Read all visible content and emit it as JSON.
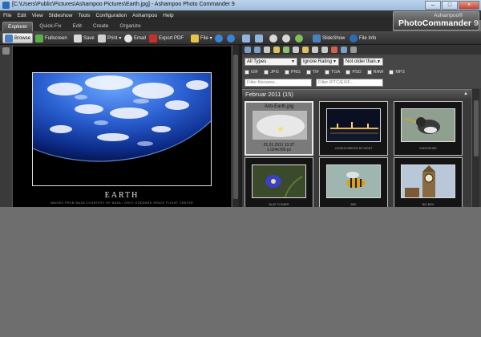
{
  "window": {
    "title": "[C:\\Users\\Public\\Pictures\\Ashampoo Pictures\\Earth.jpg] - Ashampoo Photo Commander 9",
    "min_label": "–",
    "max_label": "□",
    "close_label": "×"
  },
  "menu": [
    "File",
    "Edit",
    "View",
    "Slideshow",
    "Tools",
    "Configuration",
    "Ashampoo",
    "Help"
  ],
  "brand": {
    "top": "Ashampoo®",
    "name": "PhotoCommander",
    "version": "9"
  },
  "tabs": [
    "Explorer",
    "Quick-Fix",
    "Edit",
    "Create",
    "Organize"
  ],
  "toolbar": {
    "browse": "Browse",
    "fullscreen": "Fullscreen",
    "save": "Save",
    "print": "Print",
    "email": "Email",
    "export_pdf": "Export PDF",
    "file": "File",
    "slideshow": "SlideShow",
    "file_info": "File Info"
  },
  "viewer": {
    "caption": "EARTH",
    "subcaption": "IMAGES FROM NASA COURTESY OF NASA / GSFC GODDARD SPACE FLIGHT CENTER"
  },
  "filters": {
    "type": "All Types",
    "rating": "Ignore Rating",
    "date": "Not older than...",
    "formats": [
      "GIF",
      "JPG",
      "PNG",
      "TIF",
      "TGA",
      "PSD",
      "RAW",
      "MP3"
    ],
    "filename_placeholder": "Filter filename...",
    "iptc_placeholder": "Filter IPTC/EXIF..."
  },
  "group": {
    "label": "Februar 2011 (15)"
  },
  "thumbnails": [
    {
      "name": "Anti-Earth.jpg",
      "date": "01.01.2011 13:37",
      "size": "1.024x768 px",
      "caption": ""
    },
    {
      "name": "",
      "date": "",
      "size": "",
      "caption": "LONDON BRIDGE BY NIGHT"
    },
    {
      "name": "",
      "date": "",
      "size": "",
      "caption": "KINGFISHER"
    },
    {
      "name": "",
      "date": "",
      "size": "",
      "caption": "BLUE FLOWER"
    },
    {
      "name": "",
      "date": "",
      "size": "",
      "caption": "BEE"
    },
    {
      "name": "",
      "date": "",
      "size": "",
      "caption": "BIG BEN"
    }
  ],
  "colors": {
    "accent": "#2b6cb8",
    "app_dark": "#2a2a2a",
    "selection": "#7a7a7a"
  }
}
